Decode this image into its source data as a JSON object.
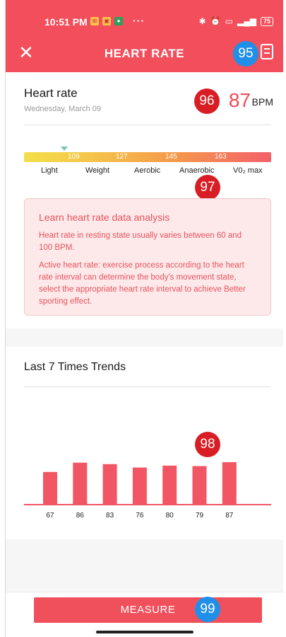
{
  "status_bar": {
    "time": "10:51 PM",
    "dots": "···",
    "battery": "75"
  },
  "header": {
    "title": "HEART RATE",
    "close_icon": "close-icon",
    "records_icon": "document-icon"
  },
  "summary": {
    "title": "Heart rate",
    "date": "Wednesday, March 09",
    "value": "87",
    "unit": "BPM"
  },
  "zones": {
    "thresholds": [
      "109",
      "127",
      "145",
      "163"
    ],
    "labels": [
      "Light",
      "Weight",
      "Aerobic",
      "Anaerobic",
      "V0₂ max"
    ],
    "colors": [
      "#f3e04a",
      "#f5c14a",
      "#f59a4a",
      "#f3606a"
    ]
  },
  "info": {
    "title": "Learn heart rate data analysis",
    "p1": "Heart rate in resting state usually varies between 60 and 100 BPM.",
    "p2": "Active heart rate: exercise process according to the heart rate interval can determine the body's movement state, select the appropriate heart rate interval to achieve Better sporting effect."
  },
  "trends": {
    "title": "Last 7 Times Trends"
  },
  "chart_data": {
    "type": "bar",
    "categories": [
      "67",
      "86",
      "83",
      "76",
      "80",
      "79",
      "87"
    ],
    "values": [
      67,
      86,
      83,
      76,
      80,
      79,
      87
    ],
    "title": "Last 7 Times Trends",
    "xlabel": "",
    "ylabel": "",
    "grid": false,
    "bar_color": "#f25664"
  },
  "footer": {
    "measure_label": "MEASURE"
  },
  "annotations": {
    "b95": "95",
    "b96": "96",
    "b97": "97",
    "b98": "98",
    "b99": "99"
  },
  "colors": {
    "accent": "#f24e5b",
    "badge_blue": "#1f8fe8",
    "badge_red": "#d81e24"
  }
}
